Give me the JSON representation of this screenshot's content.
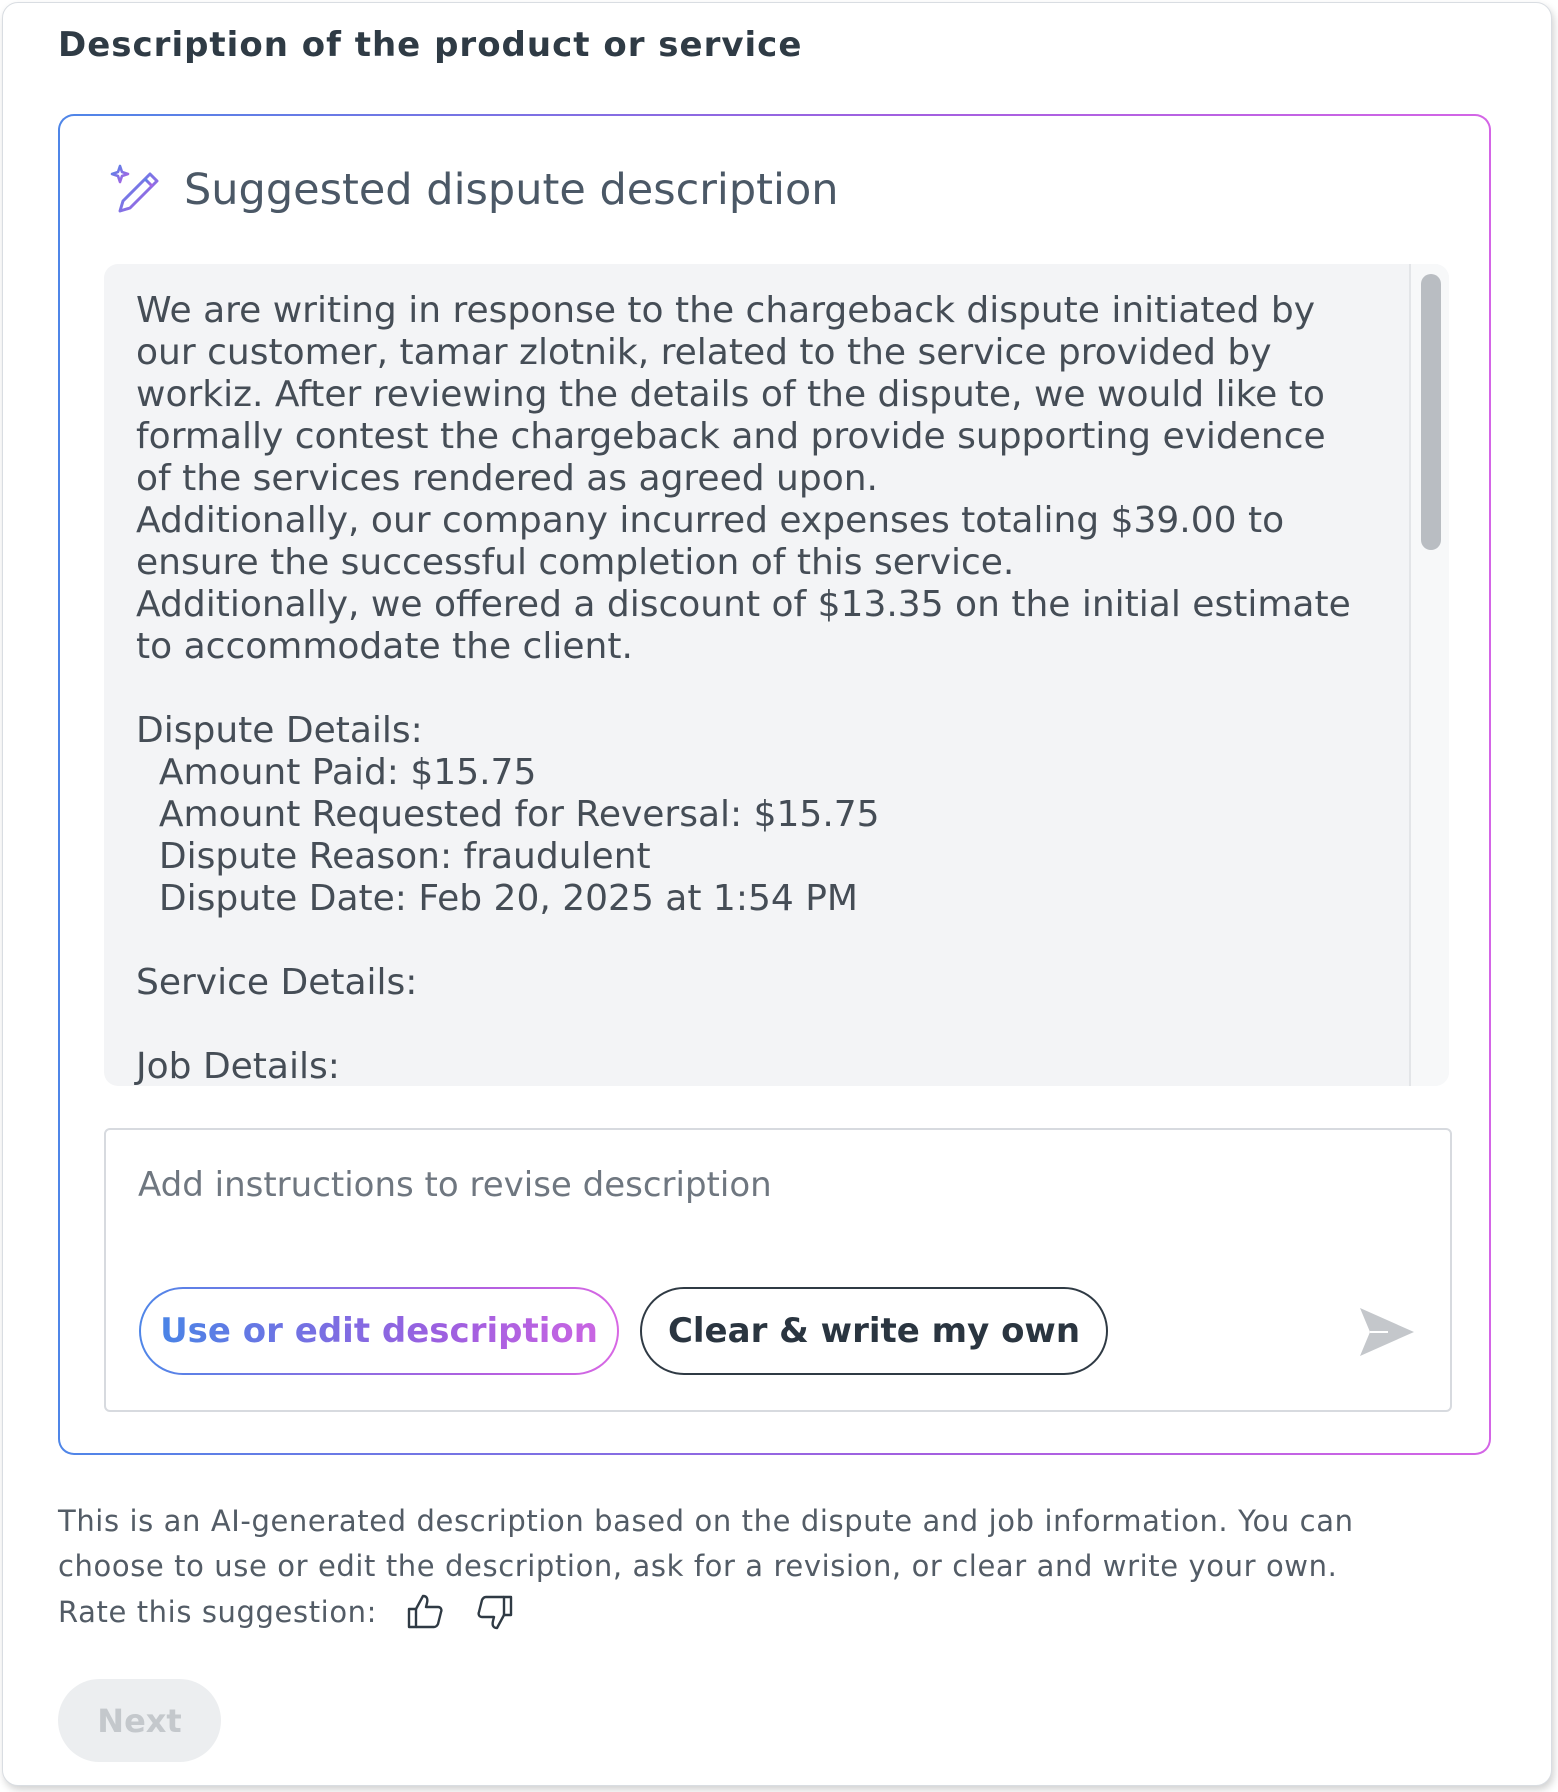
{
  "section": {
    "title": "Description of the product or service"
  },
  "suggestion": {
    "title": "Suggested dispute description",
    "icon": "magic-pencil-icon",
    "body": "We are writing in response to the chargeback dispute initiated by\nour customer, tamar zlotnik, related to the service provided by\nworkiz. After reviewing the details of the dispute, we would like to\nformally contest the chargeback and provide supporting evidence\nof the services rendered as agreed upon.\nAdditionally, our company incurred expenses totaling $39.00 to\nensure the successful completion of this service.\nAdditionally, we offered a discount of $13.35 on the initial estimate\nto accommodate the client.\n\nDispute Details:\n  Amount Paid: $15.75\n  Amount Requested for Reversal: $15.75\n  Dispute Reason: fraudulent\n  Dispute Date: Feb 20, 2025 at 1:54 PM\n\nService Details:\n\nJob Details:"
  },
  "revise": {
    "placeholder": "Add instructions to revise description",
    "value": "",
    "use_button": "Use or edit description",
    "clear_button": "Clear & write my own",
    "send_icon": "send-arrow-icon"
  },
  "footer": {
    "disclaimer": "This is an AI-generated description based on the dispute and job information. You can choose to use or edit the description, ask for a revision, or clear and write your own.",
    "rate_label": "Rate this suggestion:",
    "thumbs_up_icon": "thumbs-up-icon",
    "thumbs_down_icon": "thumbs-down-icon",
    "next_button": "Next"
  },
  "colors": {
    "gradient_start": "#4f86e8",
    "gradient_end": "#d465e6",
    "text_dark": "#2f3b45",
    "disabled_bg": "#eceef0"
  }
}
